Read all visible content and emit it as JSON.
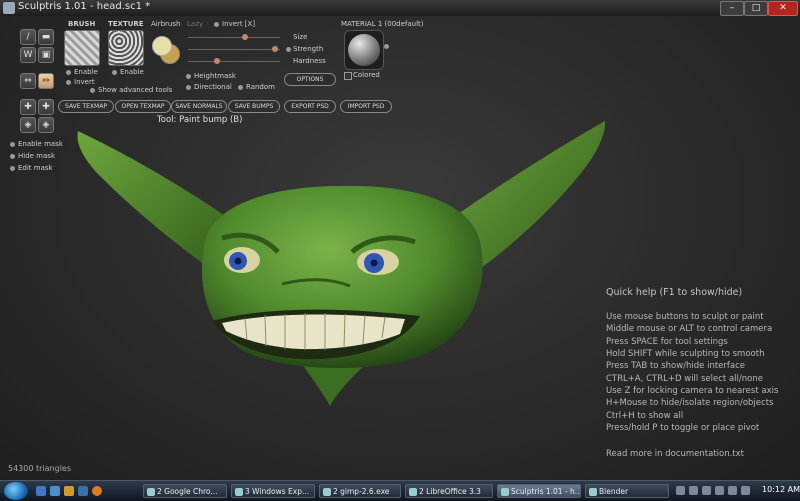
{
  "window": {
    "title": "Sculptris 1.01 - head.sc1 *",
    "minimize": "–",
    "maximize": "□",
    "close": "✕"
  },
  "panel": {
    "brush_label": "BRUSH",
    "texture_label": "TEXTURE",
    "airbrush_label": "Airbrush",
    "lazy_label": "Lazy",
    "invert_label": "Invert [X]",
    "size_label": "Size",
    "strength_label": "Strength",
    "hardness_label": "Hardness",
    "size_value": 0.62,
    "strength_value": 0.95,
    "hardness_value": 0.32,
    "material_label": "MATERIAL 1 (00default)",
    "colored_label": "Colored",
    "brush_enable": "Enable",
    "brush_invert": "Invert",
    "texture_enable": "Enable",
    "heightmask": "Heightmask",
    "directional": "Directional",
    "random": "Random",
    "show_advanced": "Show advanced tools",
    "options_button": "OPTIONS",
    "buttons": [
      "SAVE TEXMAP",
      "OPEN TEXMAP",
      "SAVE NORMALS",
      "SAVE BUMPS",
      "EXPORT PSD",
      "IMPORT PSD"
    ],
    "tool_label": "Tool: Paint bump (B)"
  },
  "toolbox": {
    "tool_glyphs": [
      "/",
      "▬",
      "W",
      "▣",
      "⇔",
      "⇔",
      "✚",
      "✚",
      "◈",
      "◈"
    ]
  },
  "mask": {
    "enable": "Enable mask",
    "hide": "Hide mask",
    "edit": "Edit mask"
  },
  "quick_help": {
    "title": "Quick help (F1 to show/hide)",
    "lines": [
      "Use mouse buttons to sculpt or paint",
      "Middle mouse or ALT to control camera",
      "Press SPACE for tool settings",
      "Hold SHIFT while sculpting to smooth",
      "Press TAB to show/hide interface",
      "CTRL+A, CTRL+D will select all/none",
      "Use Z for locking camera to nearest axis",
      "H+Mouse to hide/isolate region/objects",
      "Ctrl+H to show all",
      "Press/hold P to toggle or place pivot"
    ],
    "footer": "Read more in documentation.txt"
  },
  "status": {
    "triangles": "54300 triangles"
  },
  "taskbar": {
    "items": [
      "2 Google Chro...",
      "3 Windows Exp...",
      "2 gimp-2.6.exe",
      "2 LibreOffice 3.3",
      "Sculptris 1.01 - h...",
      "Blender"
    ],
    "active_index": 4,
    "clock": "10:12 AM"
  },
  "colors": {
    "model_green": "#4f8a2c",
    "eye_blue": "#2f57b8",
    "teeth": "#e8e4c8",
    "knob": "#c08a6a"
  }
}
